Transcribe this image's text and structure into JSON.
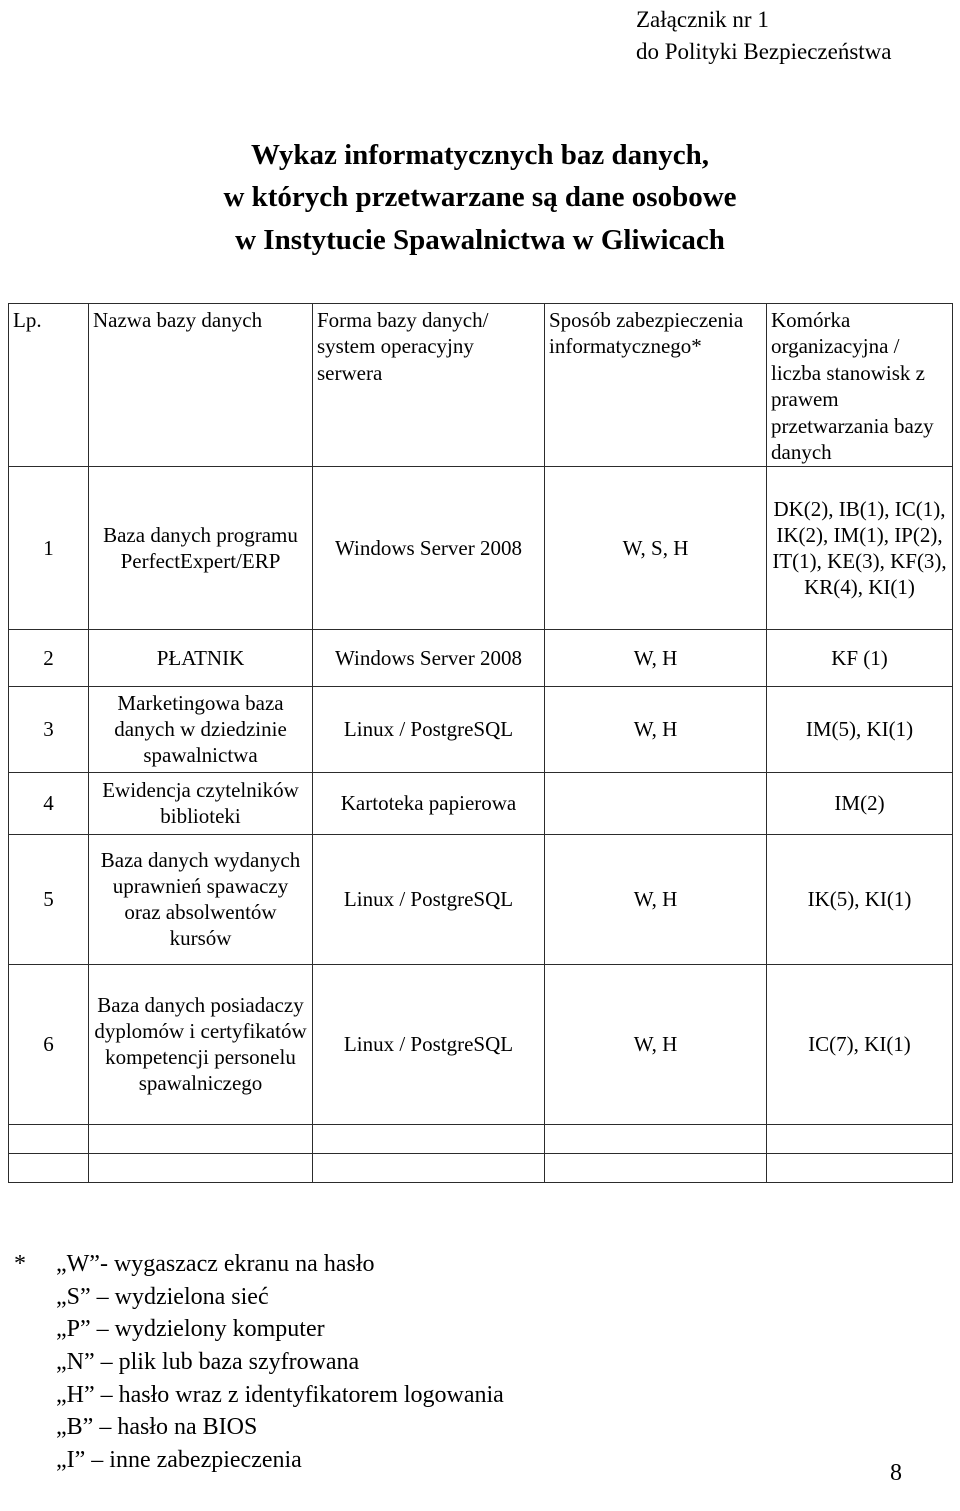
{
  "annex": {
    "line1": "Załącznik nr 1",
    "line2": "do Polityki Bezpieczeństwa"
  },
  "title": {
    "line1": "Wykaz informatycznych baz danych,",
    "line2": "w których przetwarzane są dane osobowe",
    "line3": "w Instytucie Spawalnictwa w Gliwicach"
  },
  "table": {
    "headers": {
      "lp": "Lp.",
      "name": "Nazwa bazy danych",
      "form": "Forma bazy danych/ system operacyjny serwera",
      "security": "Sposób zabezpieczenia informatycznego*",
      "org": "Komórka organizacyjna / liczba stanowisk z prawem przetwarzania bazy danych"
    },
    "rows": [
      {
        "lp": "1",
        "name": "Baza danych programu PerfectExpert/ERP",
        "form": "Windows Server 2008",
        "security": "W, S, H",
        "org": "DK(2), IB(1), IC(1), IK(2), IM(1), IP(2), IT(1), KE(3), KF(3), KR(4), KI(1)"
      },
      {
        "lp": "2",
        "name": "PŁATNIK",
        "form": "Windows Server 2008",
        "security": "W, H",
        "org": "KF (1)"
      },
      {
        "lp": "3",
        "name": "Marketingowa baza danych w dziedzinie spawalnictwa",
        "form": "Linux / PostgreSQL",
        "security": "W, H",
        "org": "IM(5), KI(1)"
      },
      {
        "lp": "4",
        "name": "Ewidencja czytelników biblioteki",
        "form": "Kartoteka papierowa",
        "security": "",
        "org": "IM(2)"
      },
      {
        "lp": "5",
        "name": "Baza danych wydanych uprawnień spawaczy oraz absolwentów kursów",
        "form": "Linux / PostgreSQL",
        "security": "W, H",
        "org": "IK(5), KI(1)"
      },
      {
        "lp": "6",
        "name": "Baza danych posiadaczy dyplomów i certyfikatów kompetencji personelu spawalniczego",
        "form": "Linux / PostgreSQL",
        "security": "W, H",
        "org": "IC(7), KI(1)"
      },
      {
        "lp": "",
        "name": "",
        "form": "",
        "security": "",
        "org": ""
      },
      {
        "lp": "",
        "name": "",
        "form": "",
        "security": "",
        "org": ""
      }
    ]
  },
  "legend": {
    "marker": "*",
    "items": [
      "„W”- wygaszacz ekranu na hasło",
      "„S” – wydzielona sieć",
      "„P” – wydzielony komputer",
      "„N” – plik lub baza szyfrowana",
      "„H” – hasło wraz z identyfikatorem logowania",
      "„B” – hasło na BIOS",
      "„I” – inne zabezpieczenia"
    ]
  },
  "page_number": "8"
}
